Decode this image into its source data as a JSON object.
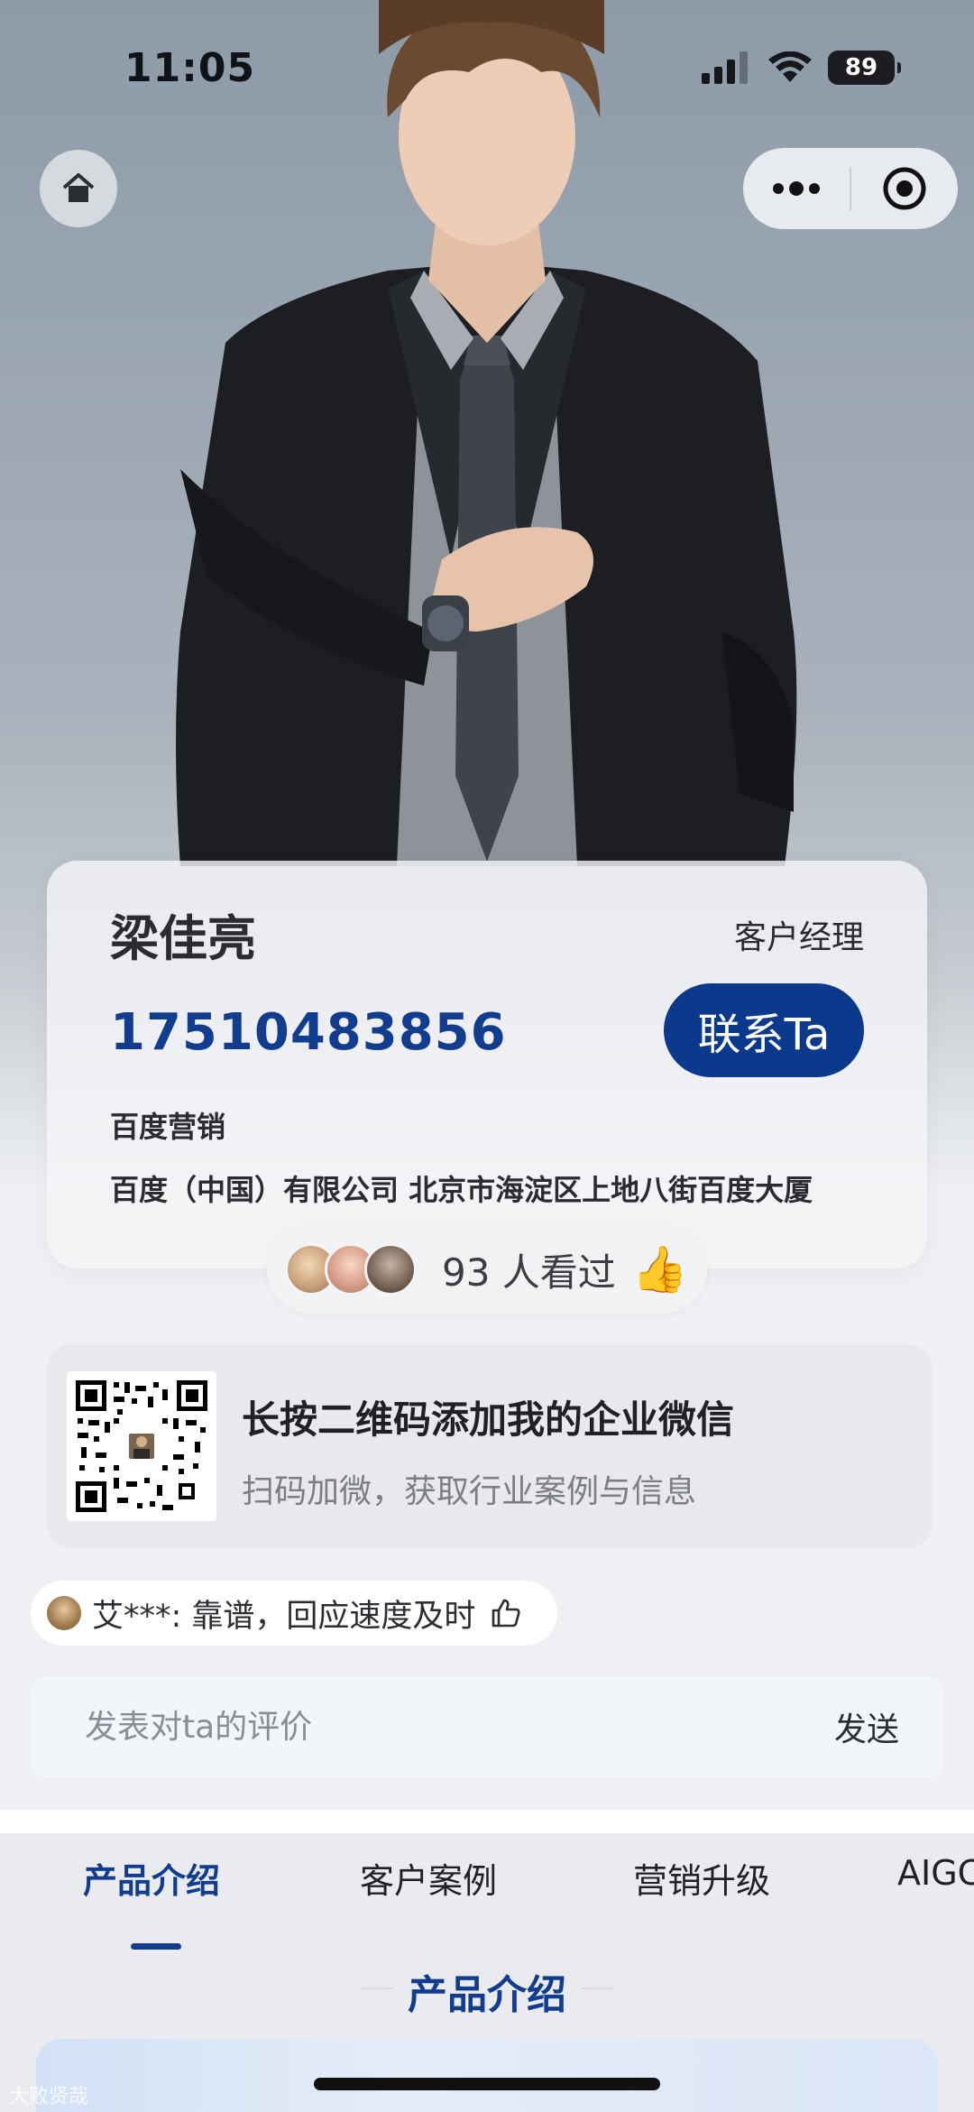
{
  "status_bar": {
    "time": "11:05",
    "battery": "89"
  },
  "profile": {
    "name": "梁佳亮",
    "role": "客户经理",
    "phone": "17510483856",
    "contact_label": "联系Ta",
    "department": "百度营销",
    "company_address": "百度（中国）有限公司 北京市海淀区上地八街百度大厦"
  },
  "views": {
    "count_text": "93 人看过",
    "emoji": "👍"
  },
  "qr": {
    "title": "长按二维码添加我的企业微信",
    "subtitle": "扫码加微，获取行业案例与信息"
  },
  "review": {
    "text": "艾***: 靠谱，回应速度及时"
  },
  "comment": {
    "placeholder": "发表对ta的评价",
    "send_label": "发送"
  },
  "tabs": [
    {
      "label": "产品介绍",
      "active": true
    },
    {
      "label": "客户案例",
      "active": false
    },
    {
      "label": "营销升级",
      "active": false
    },
    {
      "label": "AIGC",
      "active": false
    }
  ],
  "section": {
    "title": "产品介绍"
  },
  "watermark": "大败贤哉",
  "colors": {
    "brand_blue": "#123d8f",
    "button_blue": "#0b3a8d"
  }
}
